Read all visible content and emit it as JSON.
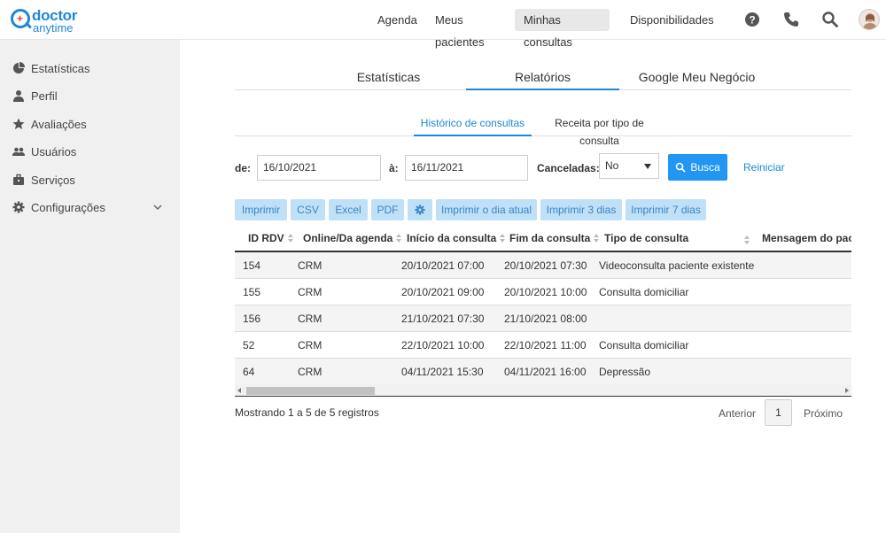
{
  "brand": {
    "line1": "doctor",
    "line2": "anytime"
  },
  "topnav": [
    "Agenda",
    "Meus pacientes",
    "Minhas consultas",
    "Disponibilidades"
  ],
  "sidebar": [
    {
      "label": "Estatísticas",
      "icon": "pie-chart-icon"
    },
    {
      "label": "Perfil",
      "icon": "doctor-icon"
    },
    {
      "label": "Avaliações",
      "icon": "star-icon"
    },
    {
      "label": "Usuários",
      "icon": "users-icon"
    },
    {
      "label": "Serviços",
      "icon": "briefcase-icon"
    },
    {
      "label": "Configurações",
      "icon": "gear-icon"
    }
  ],
  "tabs": [
    "Estatísticas",
    "Relatórios",
    "Google Meu Negócio"
  ],
  "subtabs": [
    "Histórico de consultas",
    "Receita por tipo de consulta"
  ],
  "filters": {
    "from_label": "de:",
    "from_value": "16/10/2021",
    "to_label": "à:",
    "to_value": "16/11/2021",
    "cancel_label": "Canceladas:",
    "cancel_value": "No",
    "search_label": "Busca",
    "reset_label": "Reiniciar"
  },
  "export_buttons": [
    "Imprimir",
    "CSV",
    "Excel",
    "PDF",
    "",
    "Imprimir o dia atual",
    "Imprimir 3 dias",
    "Imprimir 7 dias"
  ],
  "table": {
    "headers": [
      "ID RDV",
      "Online/Da agenda",
      "Início da consulta",
      "Fim da consulta",
      "Tipo de consulta",
      "Mensagem do paciente"
    ],
    "rows": [
      [
        "154",
        "CRM",
        "20/10/2021 07:00",
        "20/10/2021 07:30",
        "Videoconsulta paciente existente",
        ""
      ],
      [
        "155",
        "CRM",
        "20/10/2021 09:00",
        "20/10/2021 10:00",
        "Consulta domiciliar",
        ""
      ],
      [
        "156",
        "CRM",
        "21/10/2021 07:30",
        "21/10/2021 08:00",
        "",
        ""
      ],
      [
        "52",
        "CRM",
        "22/10/2021 10:00",
        "22/10/2021 11:00",
        "Consulta domiciliar",
        ""
      ],
      [
        "64",
        "CRM",
        "04/11/2021 15:30",
        "04/11/2021 16:00",
        "Depressão",
        ""
      ]
    ]
  },
  "footer": {
    "info": "Mostrando 1 a 5 de 5 registros",
    "prev": "Anterior",
    "page": "1",
    "next": "Próximo"
  },
  "colors": {
    "accent": "#1e88d8",
    "button": "#2196f3",
    "export_bg": "#bfe0f7"
  }
}
